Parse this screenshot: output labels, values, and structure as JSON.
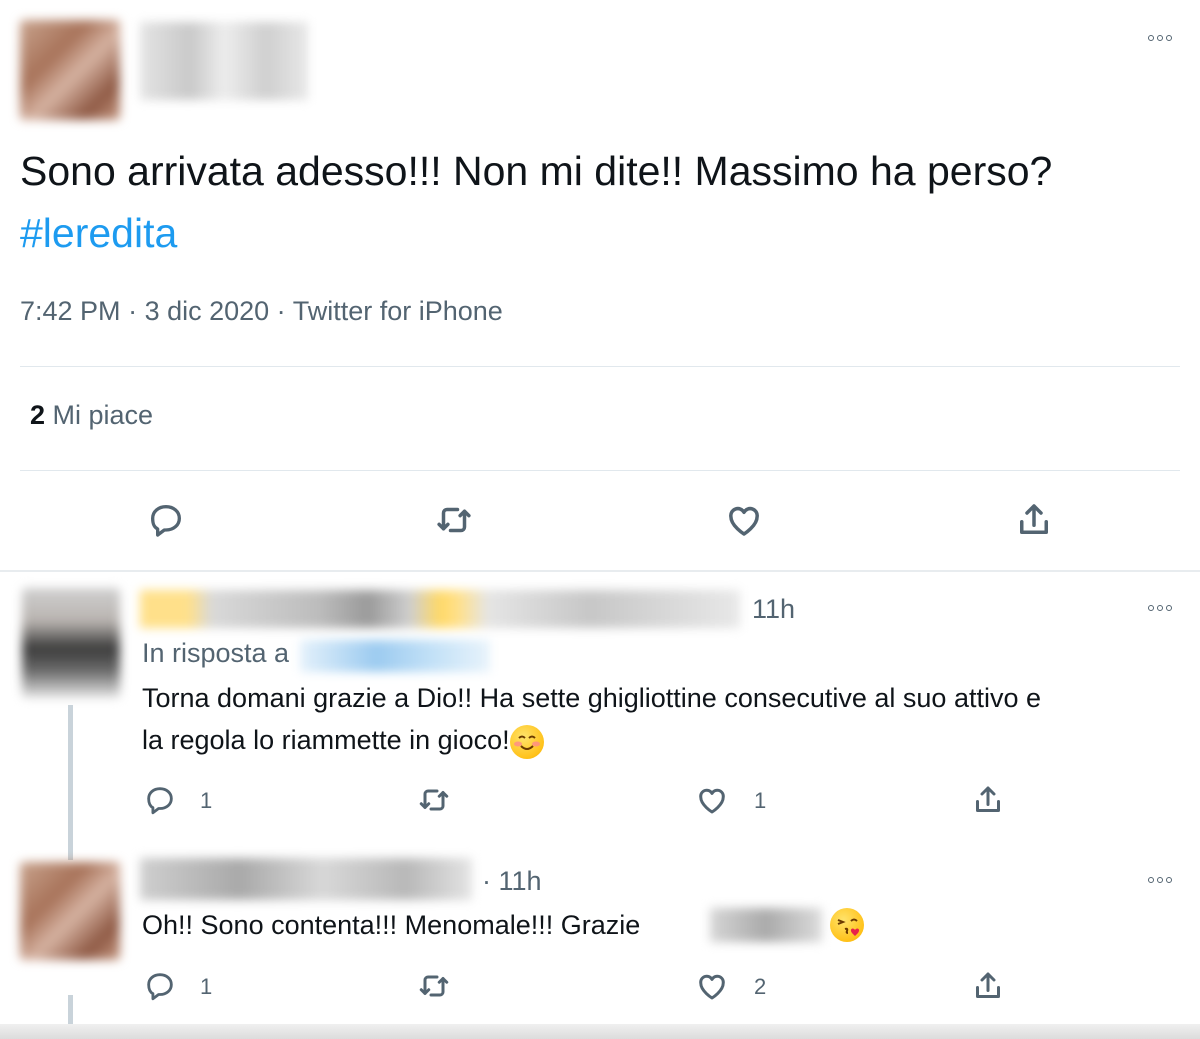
{
  "main_tweet": {
    "text_before": "Sono arrivata adesso!!! Non mi dite!! Massimo ha perso? ",
    "hashtag": "#leredita",
    "time": "7:42 PM",
    "date": "3 dic 2020",
    "source": "Twitter for iPhone",
    "meta_sep": " · ",
    "likes_count": "2",
    "likes_label": " Mi piace"
  },
  "replies": [
    {
      "time": "11h",
      "reply_to_label": "In risposta a",
      "text_line1": "Torna domani grazie a Dio!! Ha sette ghigliottine consecutive al suo attivo e",
      "text_line2": "la regola lo riammette in gioco!",
      "emoji": "smiling-face-icon",
      "reply_count": "1",
      "retweet_count": "",
      "like_count": "1"
    },
    {
      "time_prefix": "· ",
      "time": "11h",
      "text": "Oh!! Sono contenta!!! Menomale!!! Grazie",
      "emoji": "face-blowing-kiss-icon",
      "reply_count": "1",
      "retweet_count": "",
      "like_count": "2"
    }
  ],
  "colors": {
    "hashtag": "#1d9bf0",
    "secondary_text": "#536471",
    "divider": "#e1e8ed"
  }
}
